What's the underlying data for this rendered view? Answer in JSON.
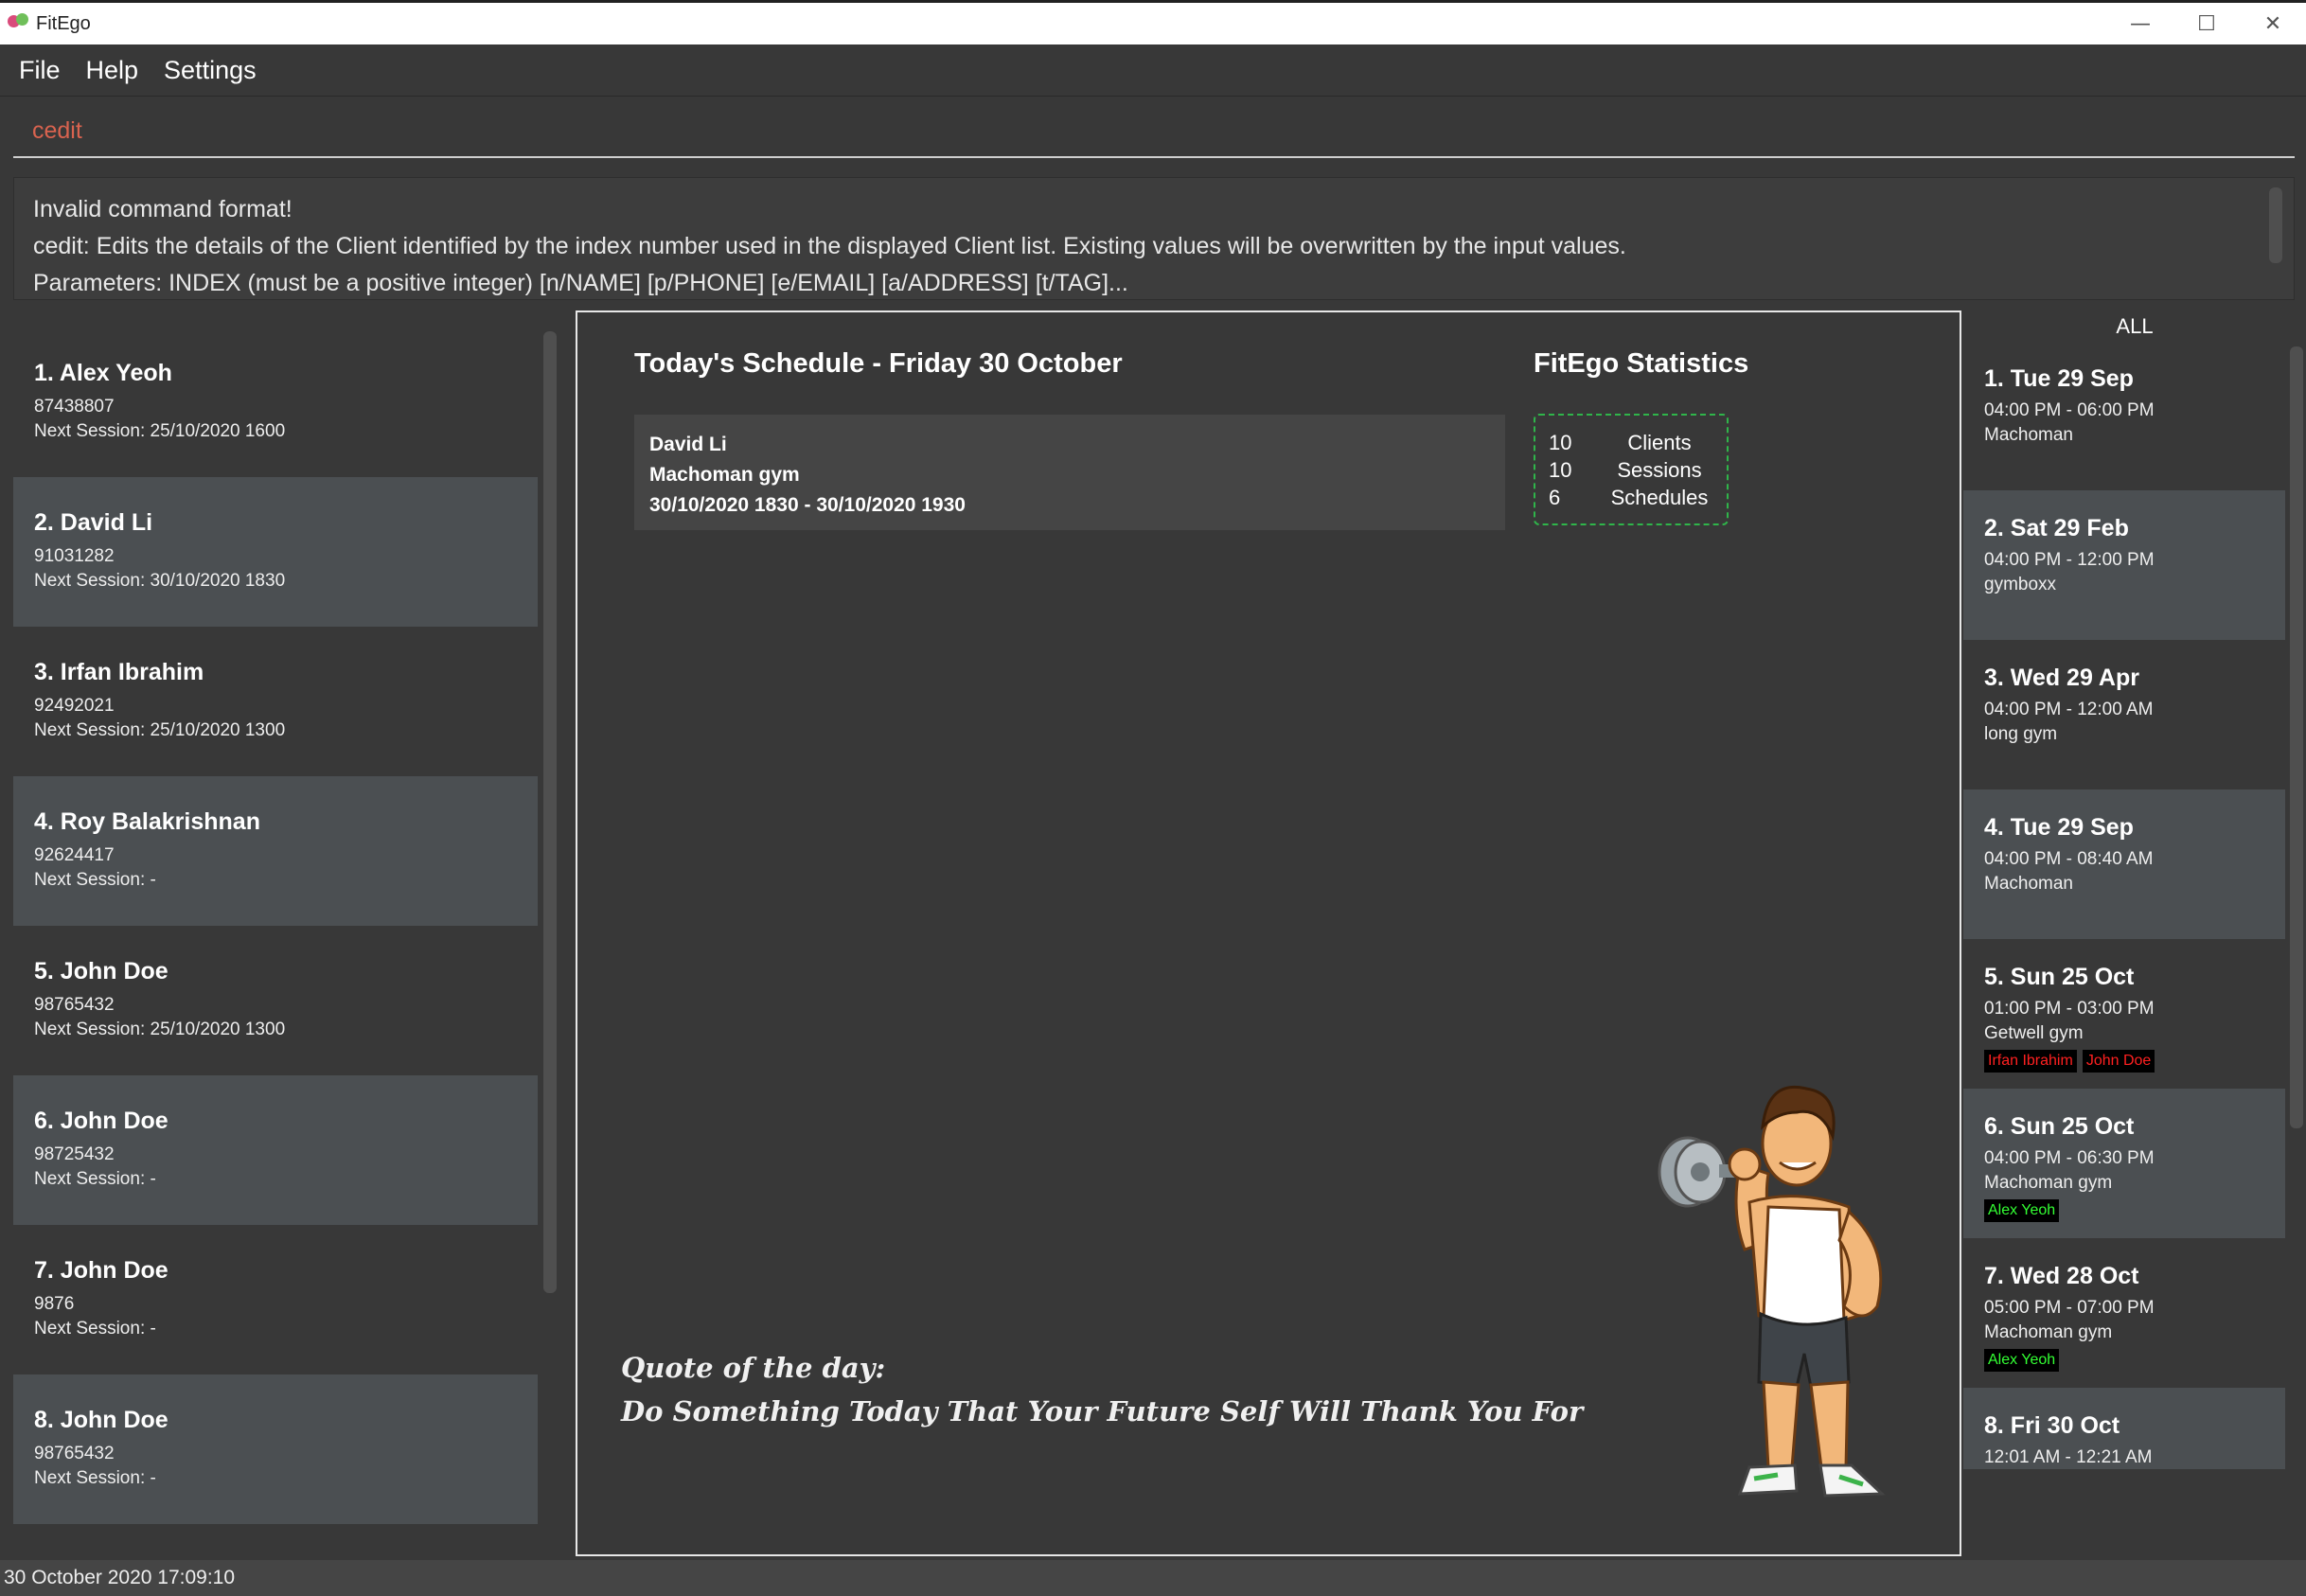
{
  "window": {
    "title": "FitEgo",
    "controls": [
      "—",
      "☐",
      "✕"
    ]
  },
  "menu": {
    "items": [
      "File",
      "Help",
      "Settings"
    ]
  },
  "command": {
    "value": "cedit"
  },
  "result": {
    "lines": [
      "Invalid command format!",
      "cedit: Edits the details of the Client identified by the index number used in the displayed Client list. Existing values will be overwritten by the input values.",
      "Parameters: INDEX (must be a positive integer) [n/NAME] [p/PHONE] [e/EMAIL] [a/ADDRESS] [t/TAG]..."
    ]
  },
  "clients": [
    {
      "title": "1.  Alex Yeoh",
      "phone": "87438807",
      "next": "Next Session: 25/10/2020 1600"
    },
    {
      "title": "2.  David Li",
      "phone": "91031282",
      "next": "Next Session: 30/10/2020 1830"
    },
    {
      "title": "3.  Irfan Ibrahim",
      "phone": "92492021",
      "next": "Next Session: 25/10/2020 1300"
    },
    {
      "title": "4.  Roy Balakrishnan",
      "phone": "92624417",
      "next": "Next Session:  -"
    },
    {
      "title": "5.  John Doe",
      "phone": "98765432",
      "next": "Next Session: 25/10/2020 1300"
    },
    {
      "title": "6.  John Doe",
      "phone": "98725432",
      "next": "Next Session:  -"
    },
    {
      "title": "7.  John Doe",
      "phone": "9876",
      "next": "Next Session:  -"
    },
    {
      "title": "8.  John Doe",
      "phone": "98765432",
      "next": "Next Session:  -"
    }
  ],
  "today": {
    "title": "Today's Schedule - Friday 30 October",
    "session": {
      "client": "David Li",
      "gym": "Machoman gym",
      "time": "30/10/2020 1830 - 30/10/2020 1930"
    }
  },
  "stats": {
    "title": "FitEgo Statistics",
    "rows": [
      {
        "num": "10",
        "label": "Clients"
      },
      {
        "num": "10",
        "label": "Sessions"
      },
      {
        "num": "6",
        "label": "Schedules"
      }
    ]
  },
  "quote": {
    "heading": "Quote of the day:",
    "text": "Do Something Today That Your Future Self Will Thank You For"
  },
  "schedule": {
    "header": "ALL",
    "items": [
      {
        "title": "1.  Tue 29 Sep",
        "time": "04:00 PM - 06:00 PM",
        "loc": "Machoman",
        "tags": []
      },
      {
        "title": "2.  Sat 29 Feb",
        "time": "04:00 PM - 12:00 PM",
        "loc": "gymboxx",
        "tags": []
      },
      {
        "title": "3.  Wed 29 Apr",
        "time": "04:00 PM - 12:00 AM",
        "loc": "long gym",
        "tags": []
      },
      {
        "title": "4.  Tue 29 Sep",
        "time": "04:00 PM - 08:40 AM",
        "loc": "Machoman",
        "tags": []
      },
      {
        "title": "5.  Sun 25 Oct",
        "time": "01:00 PM - 03:00 PM",
        "loc": "Getwell gym",
        "tags": [
          {
            "text": "Irfan Ibrahim",
            "color": "red"
          },
          {
            "text": "John Doe",
            "color": "red"
          }
        ]
      },
      {
        "title": "6.  Sun 25 Oct",
        "time": "04:00 PM - 06:30 PM",
        "loc": "Machoman gym",
        "tags": [
          {
            "text": "Alex Yeoh",
            "color": "green"
          }
        ]
      },
      {
        "title": "7.  Wed 28 Oct",
        "time": "05:00 PM - 07:00 PM",
        "loc": "Machoman gym",
        "tags": [
          {
            "text": "Alex Yeoh",
            "color": "green"
          }
        ]
      },
      {
        "title": "8.  Fri 30 Oct",
        "time": "12:01 AM - 12:21 AM",
        "loc": "",
        "tags": []
      }
    ]
  },
  "status": {
    "datetime": "30 October 2020 17:09:10"
  },
  "colors": {
    "background": "#383838",
    "card_alt": "#4b4f52",
    "command_text": "#d9634f",
    "stats_border": "#2fb54a",
    "tag_red": "#ff2020",
    "tag_green": "#33ff33"
  }
}
